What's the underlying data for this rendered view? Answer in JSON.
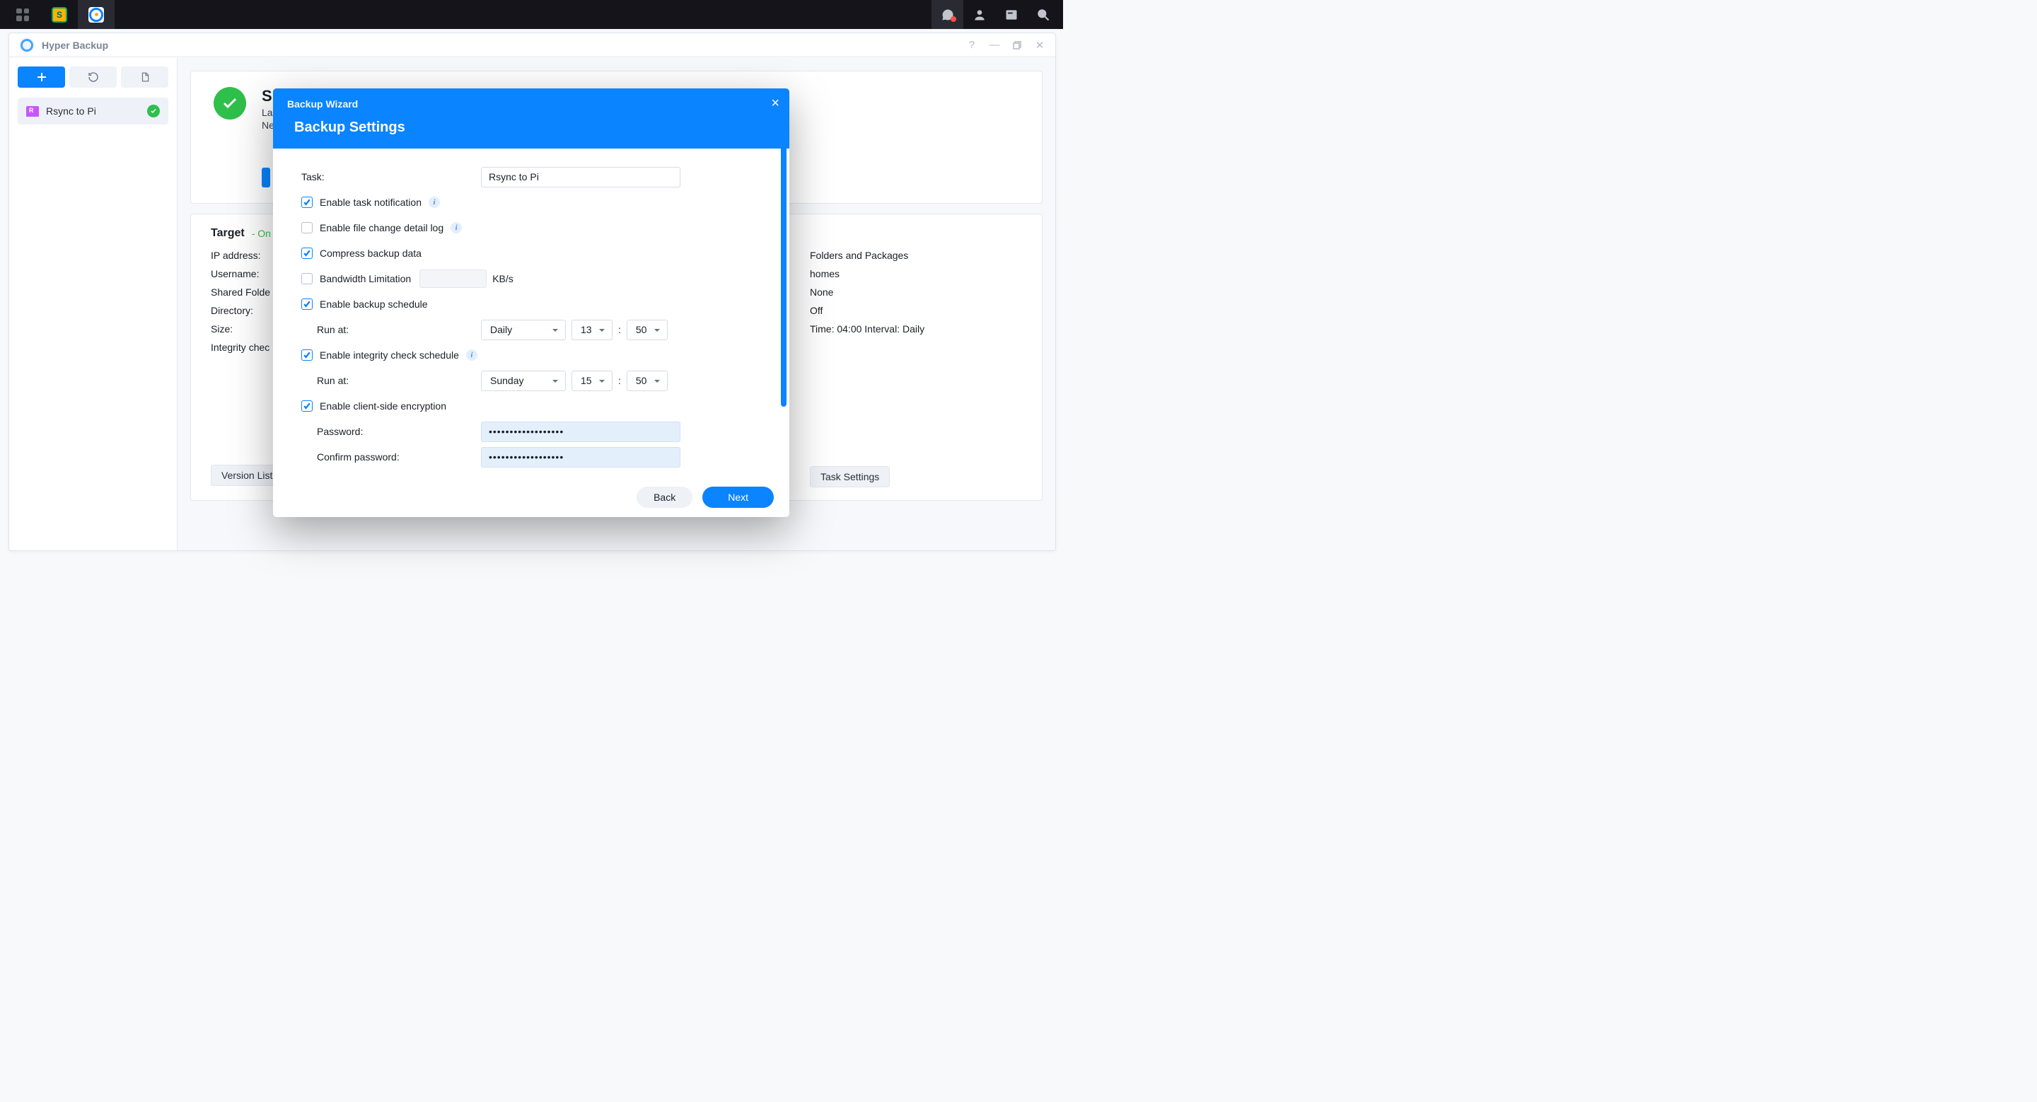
{
  "app": {
    "title": "Hyper Backup"
  },
  "sidebar": {
    "job_label": "Rsync to Pi"
  },
  "status": {
    "title_initial": "S",
    "line1_prefix": "La",
    "line2_prefix": "Ne"
  },
  "details": {
    "target_heading": "Target",
    "online": "- On",
    "ip_label": "IP address:",
    "user_label": "Username:",
    "shared_label": "Shared Folde",
    "dir_label": "Directory:",
    "size_label": "Size:",
    "integ_label": "Integrity chec",
    "right1": "Folders and Packages",
    "right2": "homes",
    "right3": "None",
    "right4": "Off",
    "right5": "Time: 04:00 Interval: Daily",
    "version_list": "Version List",
    "task_settings": "Task Settings"
  },
  "dialog": {
    "wizard": "Backup Wizard",
    "title": "Backup Settings",
    "task_label": "Task:",
    "task_value": "Rsync to Pi",
    "enable_notif": "Enable task notification",
    "enable_filelog": "Enable file change detail log",
    "compress": "Compress backup data",
    "bw_limit": "Bandwidth Limitation",
    "bw_unit": "KB/s",
    "enable_sched": "Enable backup schedule",
    "run_at": "Run at:",
    "sched_freq": "Daily",
    "sched_h": "13",
    "sched_m": "50",
    "enable_integ": "Enable integrity check schedule",
    "integ_day": "Sunday",
    "integ_h": "15",
    "integ_m": "50",
    "enable_enc": "Enable client-side encryption",
    "pwd_label": "Password:",
    "cpwd_label": "Confirm password:",
    "dots": "••••••••••••••••••",
    "back": "Back",
    "next": "Next"
  }
}
